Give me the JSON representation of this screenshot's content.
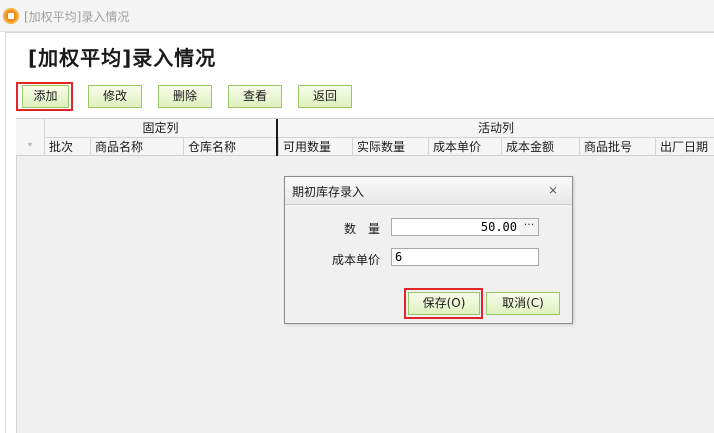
{
  "window": {
    "title": "[加权平均]录入情况"
  },
  "page": {
    "title": "[加权平均]录入情况"
  },
  "toolbar": {
    "add": "添加",
    "edit": "修改",
    "delete": "删除",
    "view": "查看",
    "back": "返回"
  },
  "grid": {
    "fixed_group": "固定列",
    "active_group": "活动列",
    "row_marker": "*",
    "fixed_columns": [
      "批次",
      "商品名称",
      "仓库名称"
    ],
    "active_columns": [
      "可用数量",
      "实际数量",
      "成本单价",
      "成本金额",
      "商品批号",
      "出厂日期"
    ]
  },
  "dialog": {
    "title": "期初库存录入",
    "quantity_label": "数　量",
    "quantity_value": "50.00",
    "unit_cost_label": "成本单价",
    "unit_cost_value": "6",
    "ellipsis": "···",
    "save_label": "保存(O)",
    "cancel_label": "取消(C)",
    "close_glyph": "⨯"
  },
  "colors": {
    "highlight": "#e0262b",
    "button_border": "#9cc66a"
  }
}
